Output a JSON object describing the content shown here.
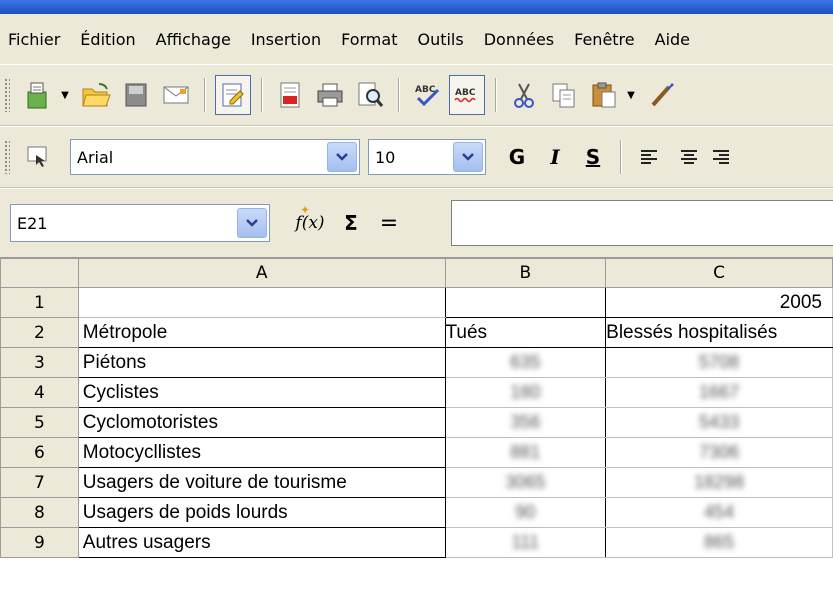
{
  "menu": [
    {
      "name": "fichier",
      "label": "Fichier"
    },
    {
      "name": "edition",
      "label": "Édition"
    },
    {
      "name": "affichage",
      "label": "Affichage"
    },
    {
      "name": "insertion",
      "label": "Insertion"
    },
    {
      "name": "format",
      "label": "Format"
    },
    {
      "name": "outils",
      "label": "Outils"
    },
    {
      "name": "donnees",
      "label": "Données"
    },
    {
      "name": "fenetre",
      "label": "Fenêtre"
    },
    {
      "name": "aide",
      "label": "Aide"
    }
  ],
  "format_toolbar": {
    "font_name": "Arial",
    "font_size": "10",
    "bold_label": "G",
    "italic_label": "I",
    "underline_label": "S"
  },
  "formula_bar": {
    "cell_ref": "E21",
    "function_label": "f(x)",
    "sum_label": "Σ",
    "equals_label": "=",
    "content": ""
  },
  "sheet": {
    "columns": [
      "A",
      "B",
      "C"
    ],
    "rows": [
      {
        "num": "1",
        "a": "",
        "b": "",
        "c": "2005"
      },
      {
        "num": "2",
        "a": "Métropole",
        "b": "Tués",
        "c": "Blessés hospitalisés"
      },
      {
        "num": "3",
        "a": "Piétons",
        "b": "635",
        "c": "5708"
      },
      {
        "num": "4",
        "a": "Cyclistes",
        "b": "180",
        "c": "1667"
      },
      {
        "num": "5",
        "a": "Cyclomotoristes",
        "b": "356",
        "c": "5433"
      },
      {
        "num": "6",
        "a": "Motocycllistes",
        "b": "881",
        "c": "7306"
      },
      {
        "num": "7",
        "a": "Usagers de voiture de tourisme",
        "b": "3065",
        "c": "18298"
      },
      {
        "num": "8",
        "a": "Usagers de poids lourds",
        "b": "90",
        "c": "454"
      },
      {
        "num": "9",
        "a": "Autres usagers",
        "b": "111",
        "c": "865"
      }
    ]
  },
  "colors": {
    "titlebar": "#2a5fd4",
    "chrome": "#ece9d8",
    "accent_border": "#4a6ea9"
  }
}
